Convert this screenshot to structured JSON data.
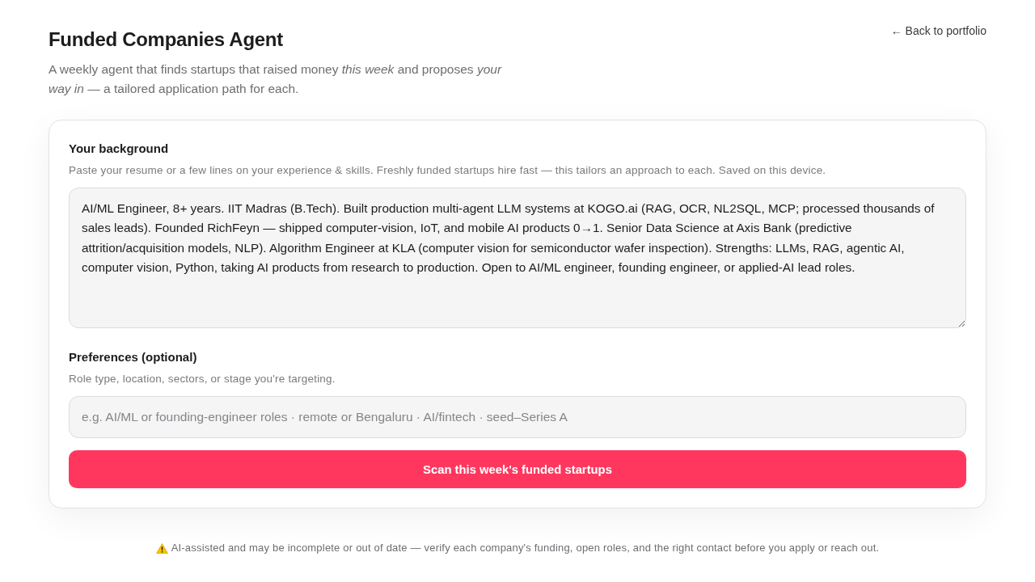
{
  "header": {
    "title": "Funded Companies Agent",
    "subtitle": "A weekly agent that finds startups that raised money *this week* and proposes *your way in* — a tailored application path for each.",
    "back_link": "← Back to portfolio"
  },
  "form": {
    "fields": [
      {
        "kind": "textarea",
        "label": "Your background",
        "hint": "Paste your resume or a few lines on your experience & skills. Freshly funded startups hire fast — this tailors an approach to each. Saved on this device.",
        "value": "AI/ML Engineer, 8+ years. IIT Madras (B.Tech). Built production multi-agent LLM systems at KOGO.ai (RAG, OCR, NL2SQL, MCP; processed thousands of sales leads). Founded RichFeyn — shipped computer-vision, IoT, and mobile AI products 0→1. Senior Data Science at Axis Bank (predictive attrition/acquisition models, NLP). Algorithm Engineer at KLA (computer vision for semiconductor wafer inspection). Strengths: LLMs, RAG, agentic AI, computer vision, Python, taking AI products from research to production. Open to AI/ML engineer, founding engineer, or applied-AI lead roles."
      },
      {
        "kind": "input",
        "label": "Preferences (optional)",
        "hint": "Role type, location, sectors, or stage you're targeting.",
        "placeholder": "e.g. AI/ML or founding-engineer roles · remote or Bengaluru · AI/fintech · seed–Series A"
      }
    ],
    "submit_button": "Scan this week's funded startups"
  },
  "disclaimer": "AI-assisted and may be incomplete or out of date — verify each company's funding, open roles, and the right contact before you apply or reach out."
}
